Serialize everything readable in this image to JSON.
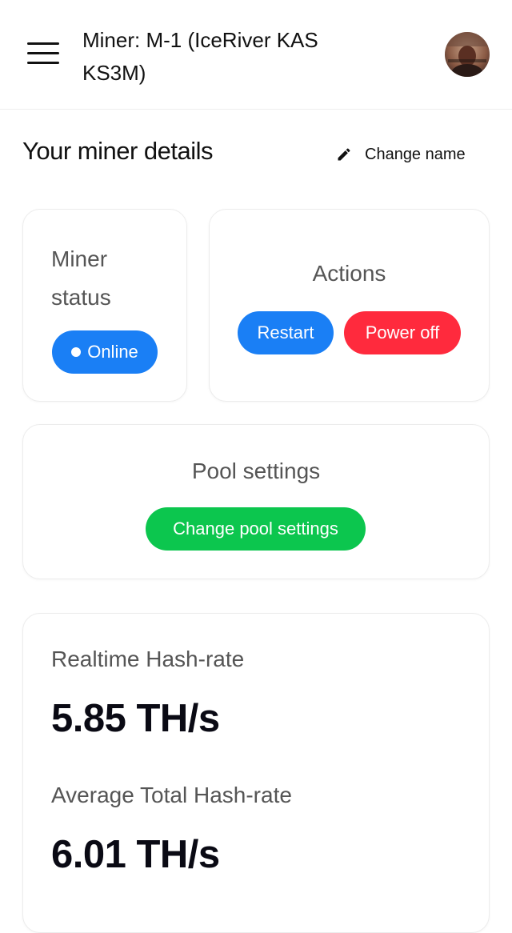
{
  "header": {
    "title": "Miner: M-1 (IceRiver KAS KS3M)",
    "menu_icon": "hamburger-menu-icon",
    "avatar_icon": "user-avatar"
  },
  "details": {
    "title": "Your miner details",
    "change_name_label": "Change name",
    "change_name_icon": "pencil-icon"
  },
  "status_card": {
    "label": "Miner status",
    "status": "Online",
    "status_color": "#1a7ff5"
  },
  "actions_card": {
    "label": "Actions",
    "restart_label": "Restart",
    "power_off_label": "Power off",
    "restart_color": "#1a7ff5",
    "power_off_color": "#ff2a3d"
  },
  "pool_card": {
    "label": "Pool settings",
    "button_label": "Change pool settings",
    "button_color": "#0cc64e"
  },
  "hashrate_card": {
    "realtime_label": "Realtime Hash-rate",
    "realtime_value": "5.85 TH/s",
    "average_label": "Average Total Hash-rate",
    "average_value": "6.01 TH/s"
  }
}
